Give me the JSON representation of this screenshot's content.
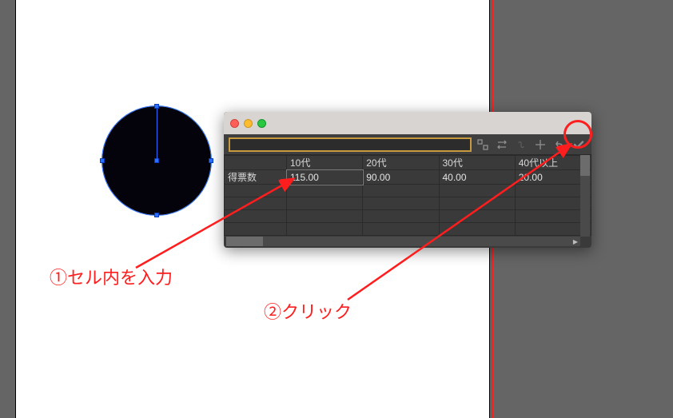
{
  "annotations": {
    "one": "①セル内を入力",
    "two": "②クリック"
  },
  "panel": {
    "toolbar": {
      "input_value": "",
      "placeholder": ""
    },
    "icons": {
      "transpose": "transpose-icon",
      "swap": "swap-cols-icon",
      "link": "link-icon",
      "grid": "grid-options-icon",
      "undo": "undo-icon",
      "confirm": "confirm-icon"
    },
    "table": {
      "row_header": "得票数",
      "columns": [
        "10代",
        "20代",
        "30代",
        "40代以上"
      ],
      "values": [
        "115.00",
        "90.00",
        "40.00",
        "20.00"
      ],
      "selected_col_index": 0
    }
  },
  "colors": {
    "annotation_red": "#ff1d1d",
    "panel_bg": "#3a3a3a",
    "input_border": "#c79a3f",
    "selection_blue": "#2a6fff"
  }
}
